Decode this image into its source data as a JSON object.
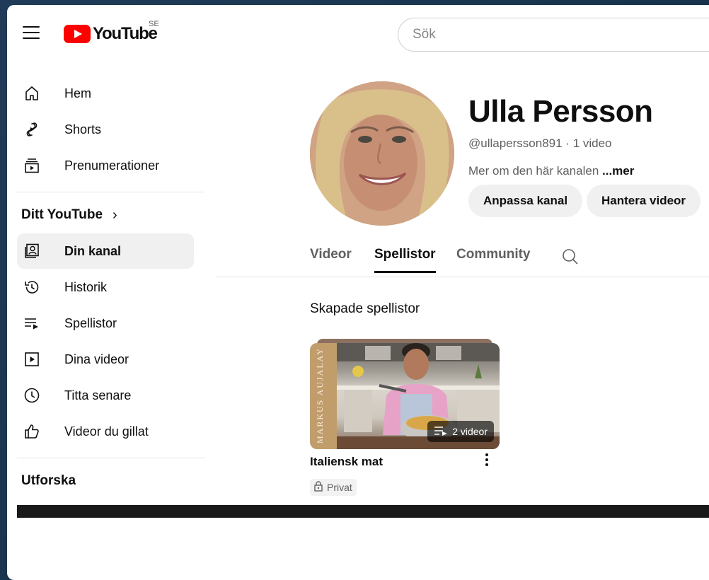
{
  "header": {
    "logo_text": "YouTube",
    "region": "SE",
    "search_placeholder": "Sök"
  },
  "sidebar": {
    "main_items": [
      {
        "label": "Hem",
        "icon": "home-icon"
      },
      {
        "label": "Shorts",
        "icon": "shorts-icon"
      },
      {
        "label": "Prenumerationer",
        "icon": "subscriptions-icon"
      }
    ],
    "you_section": {
      "title": "Ditt YouTube",
      "chevron": "›",
      "items": [
        {
          "label": "Din kanal",
          "icon": "your-channel-icon",
          "active": true
        },
        {
          "label": "Historik",
          "icon": "history-icon"
        },
        {
          "label": "Spellistor",
          "icon": "playlists-icon"
        },
        {
          "label": "Dina videor",
          "icon": "your-videos-icon"
        },
        {
          "label": "Titta senare",
          "icon": "watch-later-icon"
        },
        {
          "label": "Videor du gillat",
          "icon": "liked-videos-icon"
        }
      ]
    },
    "explore_title": "Utforska"
  },
  "channel": {
    "name": "Ulla Persson",
    "handle": "@ullapersson891",
    "separator": " · ",
    "video_count": "1 video",
    "about_text": "Mer om den här kanalen",
    "about_more": "...mer",
    "customize_label": "Anpassa kanal",
    "manage_label": "Hantera videor"
  },
  "tabs": [
    {
      "label": "Videor",
      "active": false
    },
    {
      "label": "Spellistor",
      "active": true
    },
    {
      "label": "Community",
      "active": false
    }
  ],
  "playlists": {
    "section_title": "Skapade spellistor",
    "items": [
      {
        "title": "Italiensk mat",
        "video_count": "2 videor",
        "privacy": "Privat",
        "thumbnail_spine_text": "MARKUS AUJALAY"
      }
    ]
  }
}
